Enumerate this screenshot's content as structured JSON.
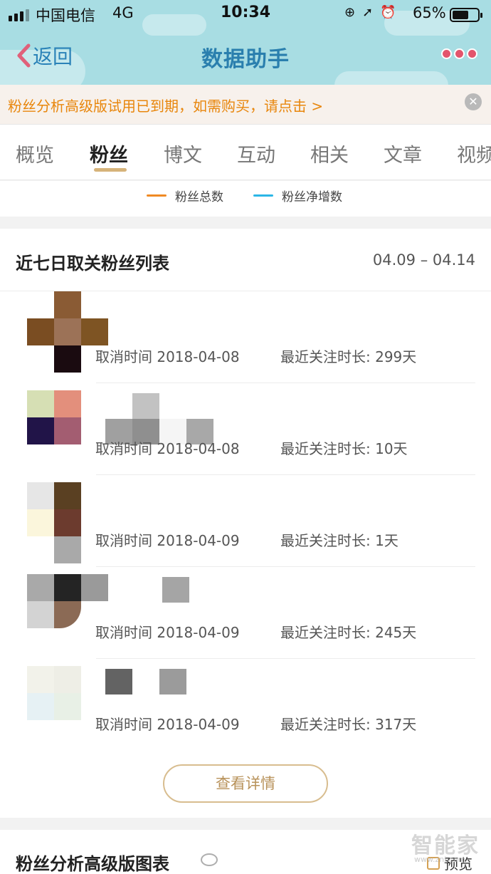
{
  "status_bar": {
    "carrier": "中国电信",
    "network": "4G",
    "time": "10:34",
    "battery_percent": "65%",
    "battery_level": 0.65
  },
  "nav": {
    "back_label": "返回",
    "title": "数据助手",
    "more_icon": "more-dots-icon"
  },
  "banner": {
    "text": "粉丝分析高级版试用已到期，如需购买，请点击 >"
  },
  "tabs": [
    {
      "label": "概览",
      "active": false
    },
    {
      "label": "粉丝",
      "active": true
    },
    {
      "label": "博文",
      "active": false
    },
    {
      "label": "互动",
      "active": false
    },
    {
      "label": "相关",
      "active": false
    },
    {
      "label": "文章",
      "active": false
    },
    {
      "label": "视频",
      "active": false
    }
  ],
  "legend": [
    {
      "label": "粉丝总数",
      "color": "#f08a24"
    },
    {
      "label": "粉丝净增数",
      "color": "#2bb6e6"
    }
  ],
  "unfollow_card": {
    "title": "近七日取关粉丝列表",
    "date_range": "04.09 – 04.14",
    "rows": [
      {
        "cancel_time": "取消时间 2018-04-08",
        "duration": "最近关注时长: 299天"
      },
      {
        "cancel_time": "取消时间 2018-04-08",
        "duration": "最近关注时长: 10天"
      },
      {
        "cancel_time": "取消时间 2018-04-09",
        "duration": "最近关注时长: 1天"
      },
      {
        "cancel_time": "取消时间 2018-04-09",
        "duration": "最近关注时长: 245天"
      },
      {
        "cancel_time": "取消时间 2018-04-09",
        "duration": "最近关注时长: 317天"
      }
    ],
    "detail_button": "查看详情"
  },
  "advanced_card": {
    "title": "粉丝分析高级版图表",
    "preview_label": "预览"
  },
  "watermark": {
    "brand": "智能家",
    "sub": "www.znj.com"
  },
  "colors": {
    "header_bg": "#a8dde3",
    "nav_title": "#2a7fae",
    "banner_text": "#e8860c",
    "active_underline": "#d6b37a",
    "button_border": "#d8bd8f"
  }
}
